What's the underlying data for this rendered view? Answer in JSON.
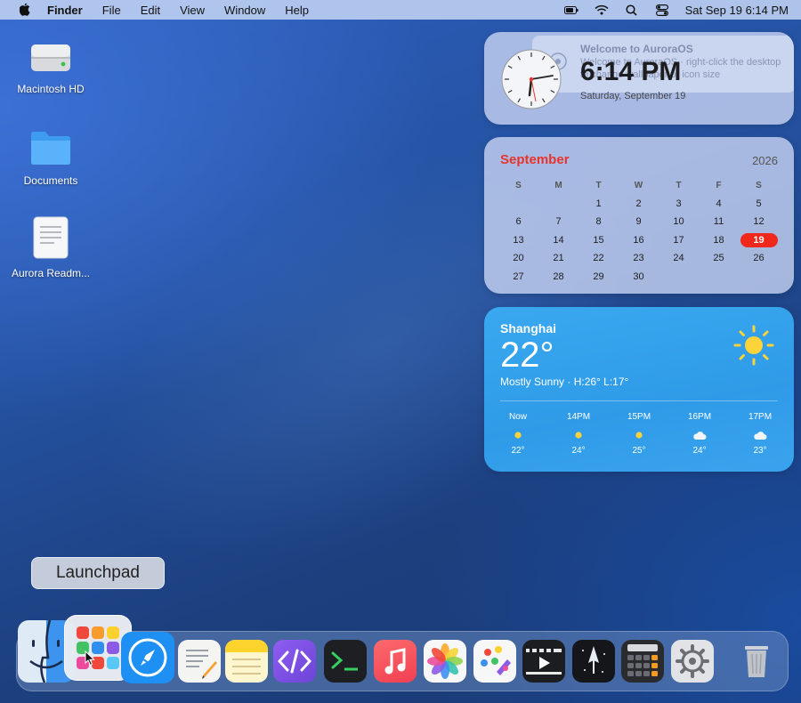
{
  "menubar": {
    "app_name": "Finder",
    "menus": [
      "File",
      "Edit",
      "View",
      "Window",
      "Help"
    ],
    "datetime": "Sat Sep 19  6:14 PM"
  },
  "desktop": {
    "icons": [
      {
        "label": "Macintosh HD",
        "icon": "hard-drive-icon"
      },
      {
        "label": "Documents",
        "icon": "folder-icon"
      },
      {
        "label": "Aurora Readm...",
        "icon": "document-icon"
      }
    ]
  },
  "clock_widget": {
    "time": "6:14 PM",
    "date": "Saturday, September 19",
    "notification_title": "Welcome to AuroraOS",
    "notification_body_1": "Welcome to AuroraOS · right-click the desktop",
    "notification_body_2": "to change wallpaper or icon size"
  },
  "calendar_widget": {
    "month": "September",
    "year": "2026",
    "weekdays": [
      "S",
      "M",
      "T",
      "W",
      "T",
      "F",
      "S"
    ],
    "weeks": [
      [
        "",
        "",
        "1",
        "2",
        "3",
        "4",
        "5"
      ],
      [
        "6",
        "7",
        "8",
        "9",
        "10",
        "11",
        "12"
      ],
      [
        "13",
        "14",
        "15",
        "16",
        "17",
        "18",
        "19"
      ],
      [
        "20",
        "21",
        "22",
        "23",
        "24",
        "25",
        "26"
      ],
      [
        "27",
        "28",
        "29",
        "30",
        "",
        "",
        ""
      ]
    ],
    "today": "19",
    "accent_color": "#e8332b"
  },
  "weather_widget": {
    "city": "Shanghai",
    "temperature": "22°",
    "condition": "Mostly Sunny · H:26° L:17°",
    "hourly": [
      {
        "label": "Now",
        "icon": "sun-dot-icon",
        "temp": "22°"
      },
      {
        "label": "14PM",
        "icon": "sun-dot-icon",
        "temp": "24°"
      },
      {
        "label": "15PM",
        "icon": "sun-dot-icon",
        "temp": "25°"
      },
      {
        "label": "16PM",
        "icon": "cloud-icon",
        "temp": "24°"
      },
      {
        "label": "17PM",
        "icon": "cloud-icon",
        "temp": "23°"
      }
    ]
  },
  "tooltip": {
    "label": "Launchpad"
  },
  "dock": {
    "apps": [
      "finder-icon",
      "launchpad-icon",
      "safari-icon",
      "textedit-icon",
      "notes-icon",
      "code-editor-icon",
      "terminal-icon",
      "music-icon",
      "photos-icon",
      "paint-icon",
      "video-player-icon",
      "launcher-icon",
      "calculator-icon",
      "settings-icon",
      "trash-icon"
    ]
  }
}
